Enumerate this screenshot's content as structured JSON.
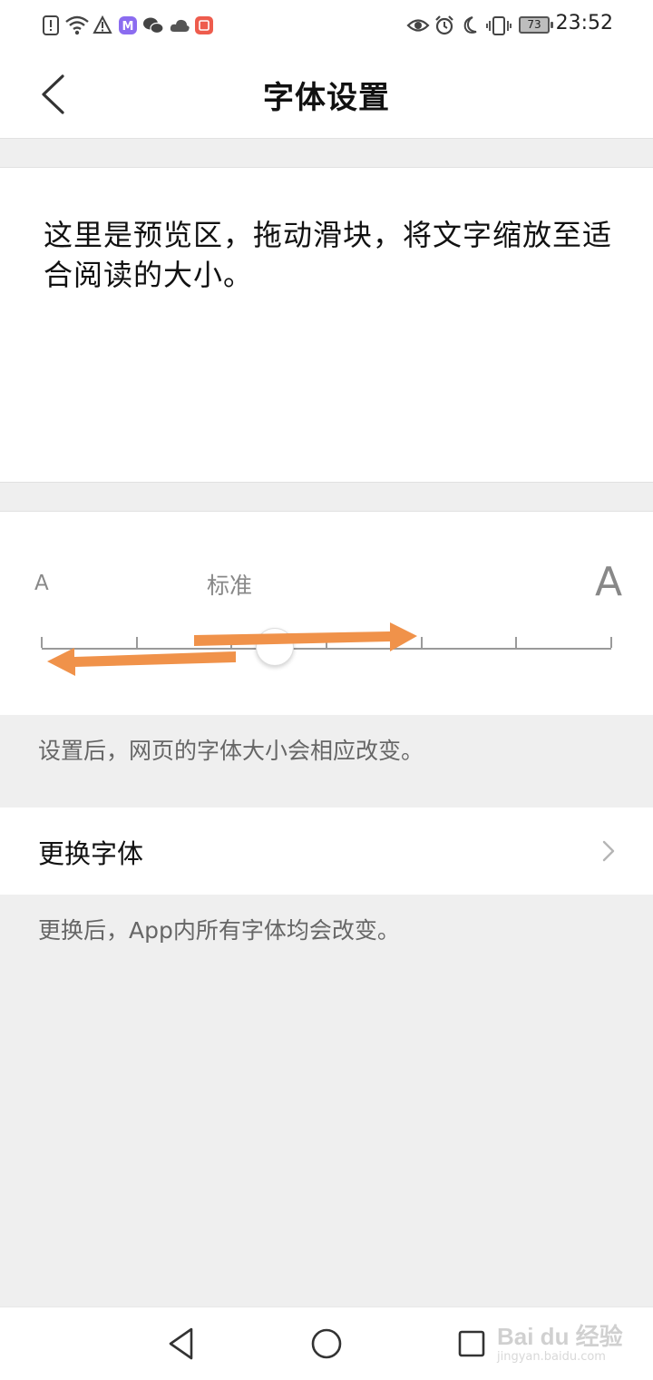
{
  "status_bar": {
    "time": "23:52",
    "battery": "73",
    "icons": [
      "alert-icon",
      "wifi-icon",
      "warning-icon",
      "app-m-icon",
      "wechat-icon",
      "cloud-icon",
      "app-red-icon",
      "eye-icon",
      "alarm-icon",
      "moon-icon",
      "vibrate-icon"
    ]
  },
  "header": {
    "title": "字体设置",
    "back_icon": "chevron-left-icon"
  },
  "preview": {
    "text": "这里是预览区，拖动滑块，将文字缩放至适合阅读的大小。"
  },
  "slider": {
    "label_small": "A",
    "label_standard": "标准",
    "label_large": "A",
    "ticks": 7,
    "selected_index": 2
  },
  "hint_webpage": "设置后，网页的字体大小会相应改变。",
  "change_font": {
    "label": "更换字体",
    "chevron_icon": "chevron-right-icon"
  },
  "hint_app": "更换后，App内所有字体均会改变。",
  "nav_keys": [
    "back-triangle-icon",
    "home-circle-icon",
    "recents-square-icon"
  ],
  "watermark": {
    "brand": "Bai du 经验",
    "url": "jingyan.baidu.com"
  },
  "colors": {
    "accent_arrow": "#f0924a",
    "background": "#efefef",
    "panel": "#ffffff"
  }
}
